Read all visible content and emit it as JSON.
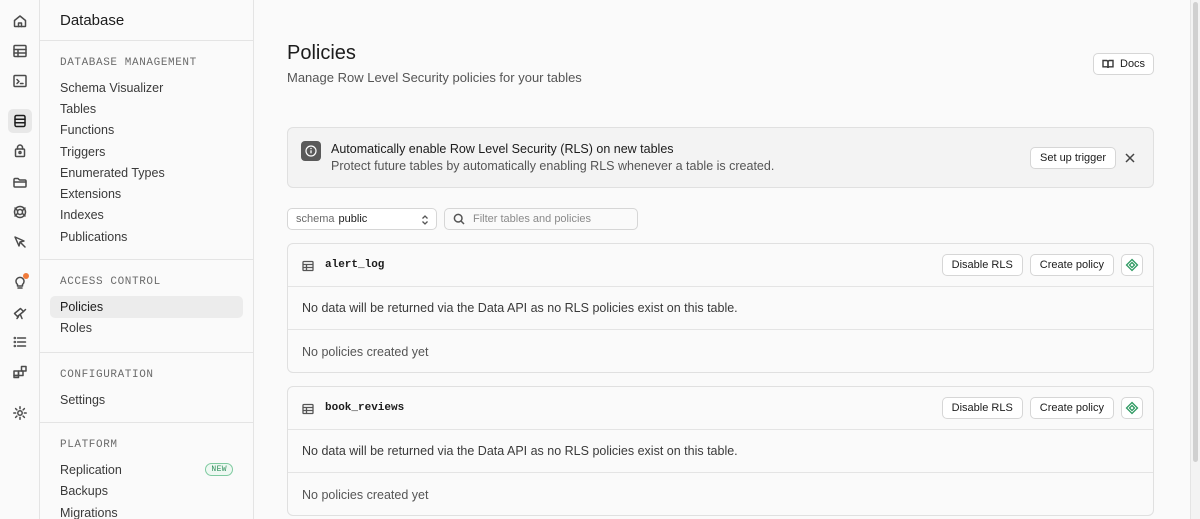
{
  "rail": {
    "icons": [
      "home-icon",
      "table-editor-icon",
      "sql-editor-icon",
      "database-icon",
      "auth-icon",
      "storage-icon",
      "realtime-icon",
      "edge-functions-icon",
      "advisors-icon",
      "reports-icon",
      "logs-icon",
      "integrations-icon",
      "settings-icon"
    ]
  },
  "sidebar": {
    "title": "Database",
    "sections": {
      "management": {
        "heading": "DATABASE MANAGEMENT",
        "items": [
          "Schema Visualizer",
          "Tables",
          "Functions",
          "Triggers",
          "Enumerated Types",
          "Extensions",
          "Indexes",
          "Publications"
        ]
      },
      "access": {
        "heading": "ACCESS CONTROL",
        "items": [
          "Policies",
          "Roles"
        ],
        "active": "Policies"
      },
      "config": {
        "heading": "CONFIGURATION",
        "items": [
          "Settings"
        ]
      },
      "platform": {
        "heading": "PLATFORM",
        "items": [
          "Replication",
          "Backups",
          "Migrations"
        ],
        "replication_badge": "NEW"
      }
    }
  },
  "main": {
    "title": "Policies",
    "subtitle": "Manage Row Level Security policies for your tables",
    "docs_label": "Docs",
    "banner": {
      "title": "Automatically enable Row Level Security (RLS) on new tables",
      "description": "Protect future tables by automatically enabling RLS whenever a table is created.",
      "action_label": "Set up trigger"
    },
    "schema": {
      "label": "schema",
      "value": "public"
    },
    "search": {
      "placeholder": "Filter tables and policies",
      "value": ""
    },
    "tables": [
      {
        "name": "alert_log",
        "disable_label": "Disable RLS",
        "create_label": "Create policy",
        "warning": "No data will be returned via the Data API as no RLS policies exist on this table.",
        "empty": "No policies created yet"
      },
      {
        "name": "book_reviews",
        "disable_label": "Disable RLS",
        "create_label": "Create policy",
        "warning": "No data will be returned via the Data API as no RLS policies exist on this table.",
        "empty": "No policies created yet"
      }
    ]
  },
  "colors": {
    "accent_green": "#2f9a62",
    "notification_dot": "#f07a3a",
    "background": "#fafafa",
    "border": "#e4e4e4"
  }
}
